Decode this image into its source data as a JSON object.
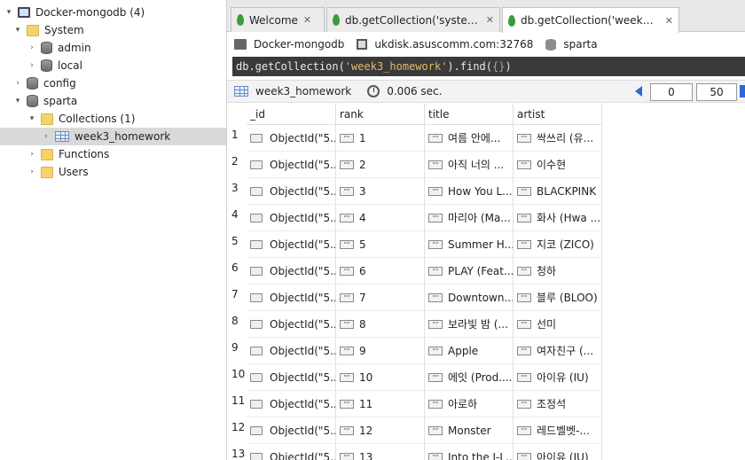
{
  "sidebar": {
    "connection": "Docker-mongodb (4)",
    "system_folder": "System",
    "system_dbs": [
      "admin",
      "local"
    ],
    "config_db": "config",
    "sparta_db": "sparta",
    "collections_folder": "Collections (1)",
    "collection": "week3_homework",
    "functions_folder": "Functions",
    "users_folder": "Users"
  },
  "tabs": [
    {
      "label": "Welcome",
      "close": "✕"
    },
    {
      "label": "db.getCollection('system,…",
      "close": "✕"
    },
    {
      "label": "db.getCollection('week3_h…",
      "close": "✕"
    }
  ],
  "connbar": {
    "connection": "Docker-mongodb",
    "host": "ukdisk.asuscomm.com:32768",
    "database": "sparta"
  },
  "query": {
    "prefix": "db.getCollection(",
    "name": "'week3_homework'",
    "mid": ").find(",
    "arg": "{}",
    "suffix": ")"
  },
  "result": {
    "collection": "week3_homework",
    "time": "0.006 sec.",
    "skip": "0",
    "limit": "50"
  },
  "table": {
    "columns": [
      "_id",
      "rank",
      "title",
      "artist"
    ],
    "rows": [
      {
        "n": "1",
        "id": "ObjectId(\"5...",
        "rank": "1",
        "title": "여름 안에...",
        "artist": "싹쓰리 (유..."
      },
      {
        "n": "2",
        "id": "ObjectId(\"5...",
        "rank": "2",
        "title": "아직 너의 ...",
        "artist": "이수현"
      },
      {
        "n": "3",
        "id": "ObjectId(\"5...",
        "rank": "3",
        "title": "How You L...",
        "artist": "BLACKPINK"
      },
      {
        "n": "4",
        "id": "ObjectId(\"5...",
        "rank": "4",
        "title": "마리아 (Ma...",
        "artist": "화사 (Hwa ..."
      },
      {
        "n": "5",
        "id": "ObjectId(\"5...",
        "rank": "5",
        "title": "Summer H...",
        "artist": "지코 (ZICO)"
      },
      {
        "n": "6",
        "id": "ObjectId(\"5...",
        "rank": "6",
        "title": "PLAY (Feat....",
        "artist": "청하"
      },
      {
        "n": "7",
        "id": "ObjectId(\"5...",
        "rank": "7",
        "title": "Downtown....",
        "artist": "블루 (BLOO)"
      },
      {
        "n": "8",
        "id": "ObjectId(\"5...",
        "rank": "8",
        "title": "보라빛 밤 (...",
        "artist": "선미"
      },
      {
        "n": "9",
        "id": "ObjectId(\"5...",
        "rank": "9",
        "title": "Apple",
        "artist": "여자친구 (..."
      },
      {
        "n": "10",
        "id": "ObjectId(\"5...",
        "rank": "10",
        "title": "에잇 (Prod....",
        "artist": "아이유 (IU)"
      },
      {
        "n": "11",
        "id": "ObjectId(\"5...",
        "rank": "11",
        "title": "아로하",
        "artist": "조정석"
      },
      {
        "n": "12",
        "id": "ObjectId(\"5...",
        "rank": "12",
        "title": "Monster",
        "artist": "레드벨벳-..."
      },
      {
        "n": "13",
        "id": "ObjectId(\"5...",
        "rank": "13",
        "title": "Into the I-L...",
        "artist": "아이유 (IU)"
      }
    ]
  }
}
